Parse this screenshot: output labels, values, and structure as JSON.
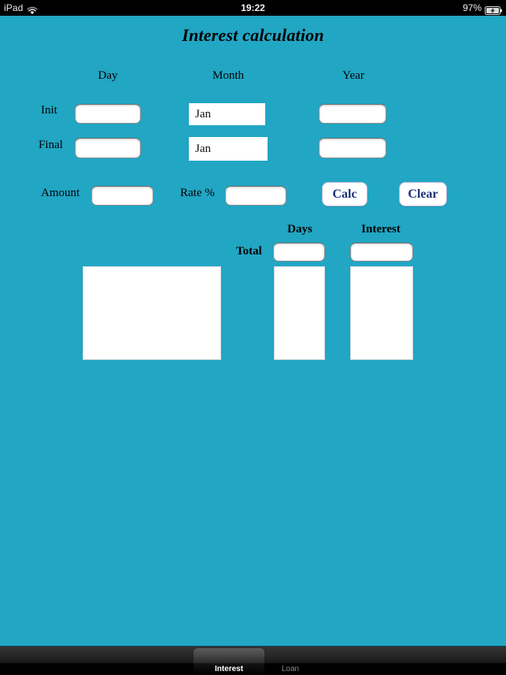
{
  "status_bar": {
    "carrier": "iPad",
    "wifi_icon": "wifi-icon",
    "time": "19:22",
    "battery_percent": "97%",
    "battery_icon": "battery-charging-icon"
  },
  "app": {
    "title": "Interest calculation",
    "background_color": "#21a6c4",
    "accent_color": "#1f3277"
  },
  "form": {
    "column_headers": {
      "day": "Day",
      "month": "Month",
      "year": "Year"
    },
    "rows": [
      {
        "label": "Init",
        "day_value": "",
        "day_placeholder": "",
        "month_value": "Jan",
        "year_value": "",
        "year_placeholder": ""
      },
      {
        "label": "Final",
        "day_value": "",
        "day_placeholder": "",
        "month_value": "Jan",
        "year_value": "",
        "year_placeholder": ""
      }
    ],
    "amount_label": "Amount",
    "amount_value": "",
    "amount_placeholder": "",
    "rate_label": "Rate %",
    "rate_value": "",
    "rate_placeholder": "",
    "calc_button": "Calc",
    "clear_button": "Clear"
  },
  "results": {
    "days_header": "Days",
    "interest_header": "Interest",
    "total_label": "Total",
    "total_days_value": "",
    "total_interest_value": "",
    "detail_rows": [],
    "days_rows": [],
    "interest_rows": []
  },
  "tab_bar": {
    "tabs": [
      {
        "label": "Interest",
        "selected": true
      },
      {
        "label": "Loan",
        "selected": false
      }
    ]
  }
}
